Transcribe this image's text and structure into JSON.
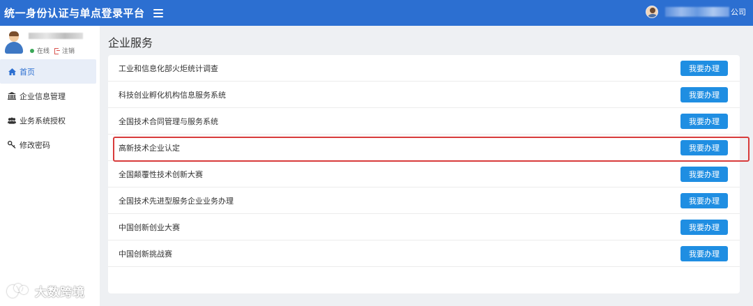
{
  "header": {
    "title": "统一身份认证与单点登录平台",
    "company_suffix": "公司"
  },
  "sidebar": {
    "user": {
      "status_online": "在线",
      "logout": "注销"
    },
    "items": [
      {
        "label": "首页",
        "icon": "home-icon",
        "active": true
      },
      {
        "label": "企业信息管理",
        "icon": "bank-icon",
        "active": false
      },
      {
        "label": "业务系统授权",
        "icon": "users-icon",
        "active": false
      },
      {
        "label": "修改密码",
        "icon": "key-icon",
        "active": false
      }
    ]
  },
  "main": {
    "title": "企业服务",
    "services": [
      {
        "label": "工业和信息化部火炬统计调查",
        "button": "我要办理"
      },
      {
        "label": "科技创业孵化机构信息服务系统",
        "button": "我要办理"
      },
      {
        "label": "全国技术合同管理与服务系统",
        "button": "我要办理"
      },
      {
        "label": "高新技术企业认定",
        "button": "我要办理",
        "highlighted": true
      },
      {
        "label": "全国颠覆性技术创新大赛",
        "button": "我要办理"
      },
      {
        "label": "全国技术先进型服务企业业务办理",
        "button": "我要办理"
      },
      {
        "label": "中国创新创业大赛",
        "button": "我要办理"
      },
      {
        "label": "中国创新挑战赛",
        "button": "我要办理"
      }
    ]
  },
  "watermark": {
    "text": "大数跨境"
  },
  "colors": {
    "header_bg": "#2c6fd1",
    "button_bg": "#1f8ee2",
    "highlight_border": "#d83b3b"
  }
}
